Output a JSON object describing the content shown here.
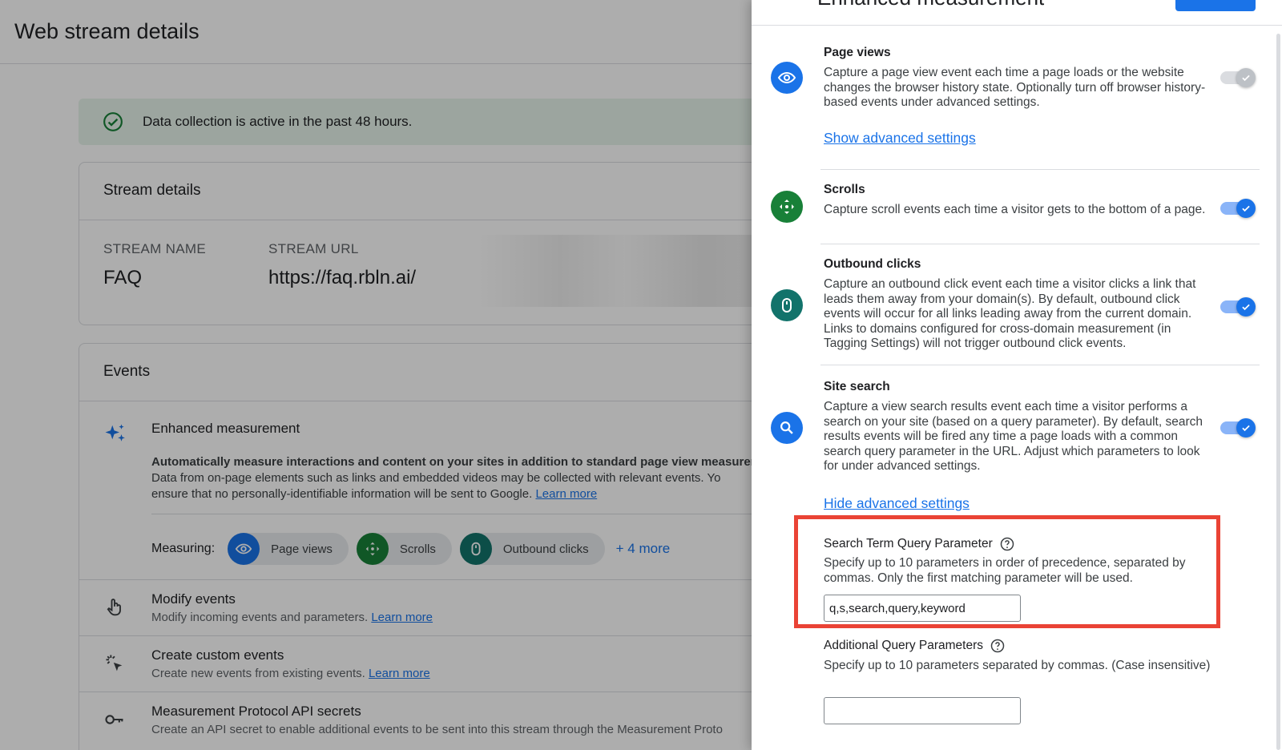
{
  "page": {
    "title": "Web stream details",
    "banner_text": "Data collection is active in the past 48 hours.",
    "stream_card": {
      "header": "Stream details",
      "stream_name_label": "STREAM NAME",
      "stream_name_value": "FAQ",
      "stream_url_label": "STREAM URL",
      "stream_url_value": "https://faq.rbln.ai/"
    },
    "events_card": {
      "header": "Events",
      "enhanced_title": "Enhanced measurement",
      "enhanced_desc_1": "Automatically measure interactions and content on your sites in addition to standard page view measurem",
      "enhanced_desc_2": "Data from on-page elements such as links and embedded videos may be collected with relevant events. Yo",
      "enhanced_desc_3": "ensure that no personally-identifiable information will be sent to Google.",
      "learn_more": "Learn more",
      "measuring_label": "Measuring:",
      "chips": [
        {
          "label": "Page views",
          "color": "#1a73e8"
        },
        {
          "label": "Scrolls",
          "color": "#188038"
        },
        {
          "label": "Outbound clicks",
          "color": "#12736b"
        }
      ],
      "more_link": "+ 4 more",
      "rows": [
        {
          "title": "Modify events",
          "sub": "Modify incoming events and parameters.",
          "link": "Learn more"
        },
        {
          "title": "Create custom events",
          "sub": "Create new events from existing events.",
          "link": "Learn more"
        },
        {
          "title": "Measurement Protocol API secrets",
          "sub": "Create an API secret to enable additional events to be sent into this stream through the Measurement Proto",
          "link": ""
        }
      ]
    }
  },
  "panel": {
    "title": "Enhanced measurement",
    "sections": {
      "page_views": {
        "title": "Page views",
        "desc": "Capture a page view event each time a page loads or the website changes the browser history state. Optionally turn off browser history-based events under advanced settings.",
        "link": "Show advanced settings",
        "icon_color": "#1a73e8",
        "toggle": "on-disabled"
      },
      "scrolls": {
        "title": "Scrolls",
        "desc": "Capture scroll events each time a visitor gets to the bottom of a page.",
        "icon_color": "#188038",
        "toggle": "on"
      },
      "outbound": {
        "title": "Outbound clicks",
        "desc": "Capture an outbound click event each time a visitor clicks a link that leads them away from your domain(s). By default, outbound click events will occur for all links leading away from the current domain. Links to domains configured for cross-domain measurement (in Tagging Settings) will not trigger outbound click events.",
        "icon_color": "#12736b",
        "toggle": "on"
      },
      "site_search": {
        "title": "Site search",
        "desc": "Capture a view search results event each time a visitor performs a search on your site (based on a query parameter). By default, search results events will be fired any time a page loads with a common search query parameter in the URL. Adjust which parameters to look for under advanced settings.",
        "link": "Hide advanced settings",
        "icon_color": "#1a73e8",
        "toggle": "on"
      }
    },
    "search_term": {
      "title": "Search Term Query Parameter",
      "desc": "Specify up to 10 parameters in order of precedence, separated by commas. Only the first matching parameter will be used.",
      "value": "q,s,search,query,keyword"
    },
    "additional": {
      "title": "Additional Query Parameters",
      "desc": "Specify up to 10 parameters separated by commas. (Case insensitive)",
      "value": ""
    },
    "highlight_color": "#ea4335"
  }
}
